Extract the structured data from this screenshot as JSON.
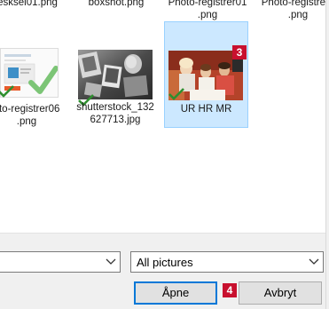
{
  "files": {
    "top_row": [
      {
        "name": "esksel01.png"
      },
      {
        "name": "boxshot.png"
      },
      {
        "name": "Photo-registrer01\n.png"
      },
      {
        "name": "Photo-registrer0\n.png"
      }
    ],
    "items": [
      {
        "name": "oto-registrer06\n.png",
        "checked": true,
        "selected": false,
        "thumb": "screenshot"
      },
      {
        "name": "shutterstock_132\n627713.jpg",
        "checked": true,
        "selected": false,
        "thumb": "bw-photo"
      },
      {
        "name": "UR HR MR",
        "checked": true,
        "selected": true,
        "thumb": "color-photo",
        "badge": "3"
      }
    ]
  },
  "bottom": {
    "filename_value": "",
    "file_type": "All pictures",
    "open_label": "Åpne",
    "cancel_label": "Avbryt",
    "badge": "4"
  },
  "colors": {
    "selection_bg": "#cce8ff",
    "selection_border": "#99d1ff",
    "badge": "#c8102e",
    "check": "#2f8f2f",
    "default_button_border": "#0078d7"
  },
  "icons": {
    "check": "checkmark-icon",
    "chevron": "chevron-down-icon"
  }
}
